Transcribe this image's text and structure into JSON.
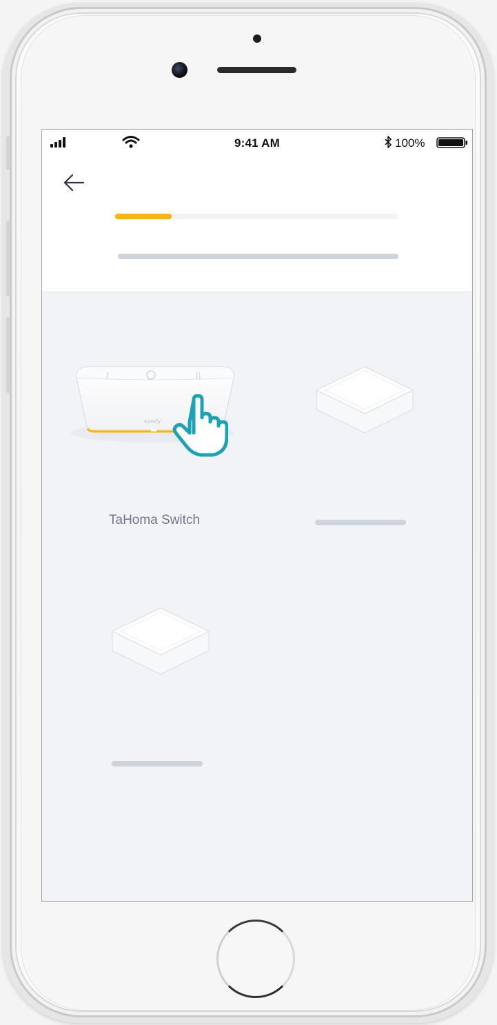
{
  "status_bar": {
    "time": "9:41 AM",
    "battery": "100%",
    "icons": [
      "signal-icon",
      "wifi-icon",
      "bluetooth-icon",
      "battery-icon"
    ]
  },
  "header": {
    "back_icon": "arrow-left-icon",
    "progress": 0.2
  },
  "devices": [
    {
      "label": "TaHoma Switch",
      "brand_mark": "somfy",
      "selected": true,
      "hint_icon": "tap-hand-icon"
    },
    {
      "label": "",
      "placeholder": true
    },
    {
      "label": "",
      "placeholder": true
    }
  ],
  "colors": {
    "accent": "#f5b50e",
    "hand": "#1ba3b5",
    "skeleton": "#cfd3da",
    "screen_bg": "#f2f3f7"
  }
}
